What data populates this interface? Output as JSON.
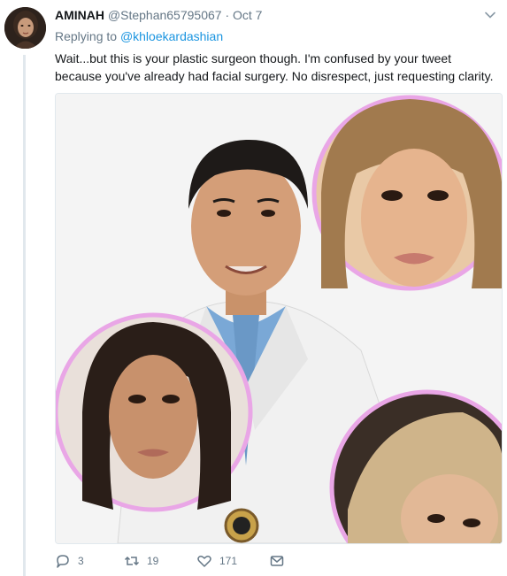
{
  "tweet": {
    "name": "AMINAH",
    "handle": "@Stephan65795067",
    "separator": "·",
    "time": "Oct 7",
    "replying_prefix": "Replying to",
    "replying_to": "@khloekardashian",
    "text": "Wait...but this is your plastic surgeon though. I'm confused by your tweet because you've already had facial surgery. No disrespect, just requesting clarity."
  },
  "actions": {
    "replies": "3",
    "retweets": "19",
    "likes": "171"
  },
  "icons": {
    "more": "chevron-down-icon",
    "reply": "reply-icon",
    "retweet": "retweet-icon",
    "like": "heart-icon",
    "message": "envelope-icon"
  },
  "colors": {
    "link": "#1b95e0",
    "secondary_text": "#657786",
    "frame_circle": "#e9a6e6"
  }
}
